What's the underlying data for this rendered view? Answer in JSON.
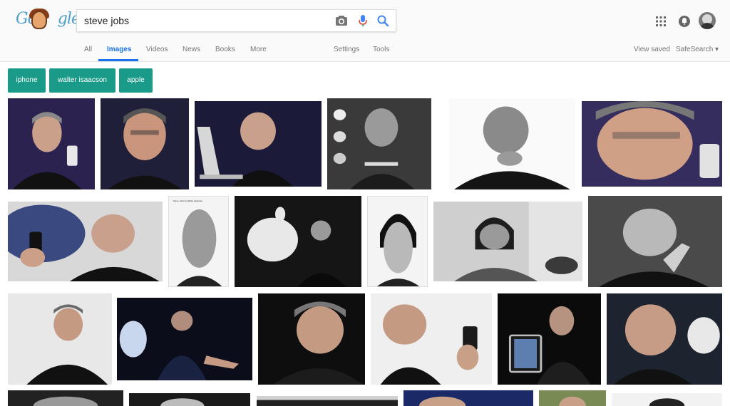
{
  "search": {
    "query": "steve jobs"
  },
  "tabs": {
    "all": "All",
    "images": "Images",
    "videos": "Videos",
    "news": "News",
    "books": "Books",
    "more": "More",
    "settings": "Settings",
    "tools": "Tools"
  },
  "right_links": {
    "view_saved": "View saved",
    "safesearch": "SafeSearch"
  },
  "chips": [
    "iphone",
    "walter isaacson",
    "apple"
  ],
  "book_cover_caption": "Steve Jobs by Walter Isaacson",
  "colors": {
    "accent_blue": "#1a73e8",
    "chip_teal": "#1a9b8a",
    "header_bg": "#fafafa"
  },
  "icons": {
    "logo": "google-doodle-logo",
    "camera": "camera-icon",
    "mic": "microphone-icon",
    "search": "search-icon",
    "apps": "apps-grid-icon",
    "notifications": "notifications-icon",
    "account": "account-avatar"
  }
}
